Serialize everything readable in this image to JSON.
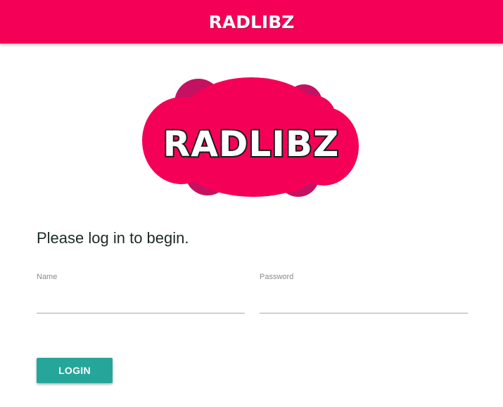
{
  "header": {
    "title": "RADLIBZ"
  },
  "logo": {
    "text": "RADLIBZ"
  },
  "main": {
    "prompt": "Please log in to begin."
  },
  "form": {
    "name_label": "Name",
    "name_value": "",
    "password_label": "Password",
    "password_value": "",
    "login_label": "LOGIN"
  },
  "colors": {
    "brand_pink": "#f50057",
    "brand_pink_dark": "#c51162",
    "button_teal": "#26a69a"
  }
}
